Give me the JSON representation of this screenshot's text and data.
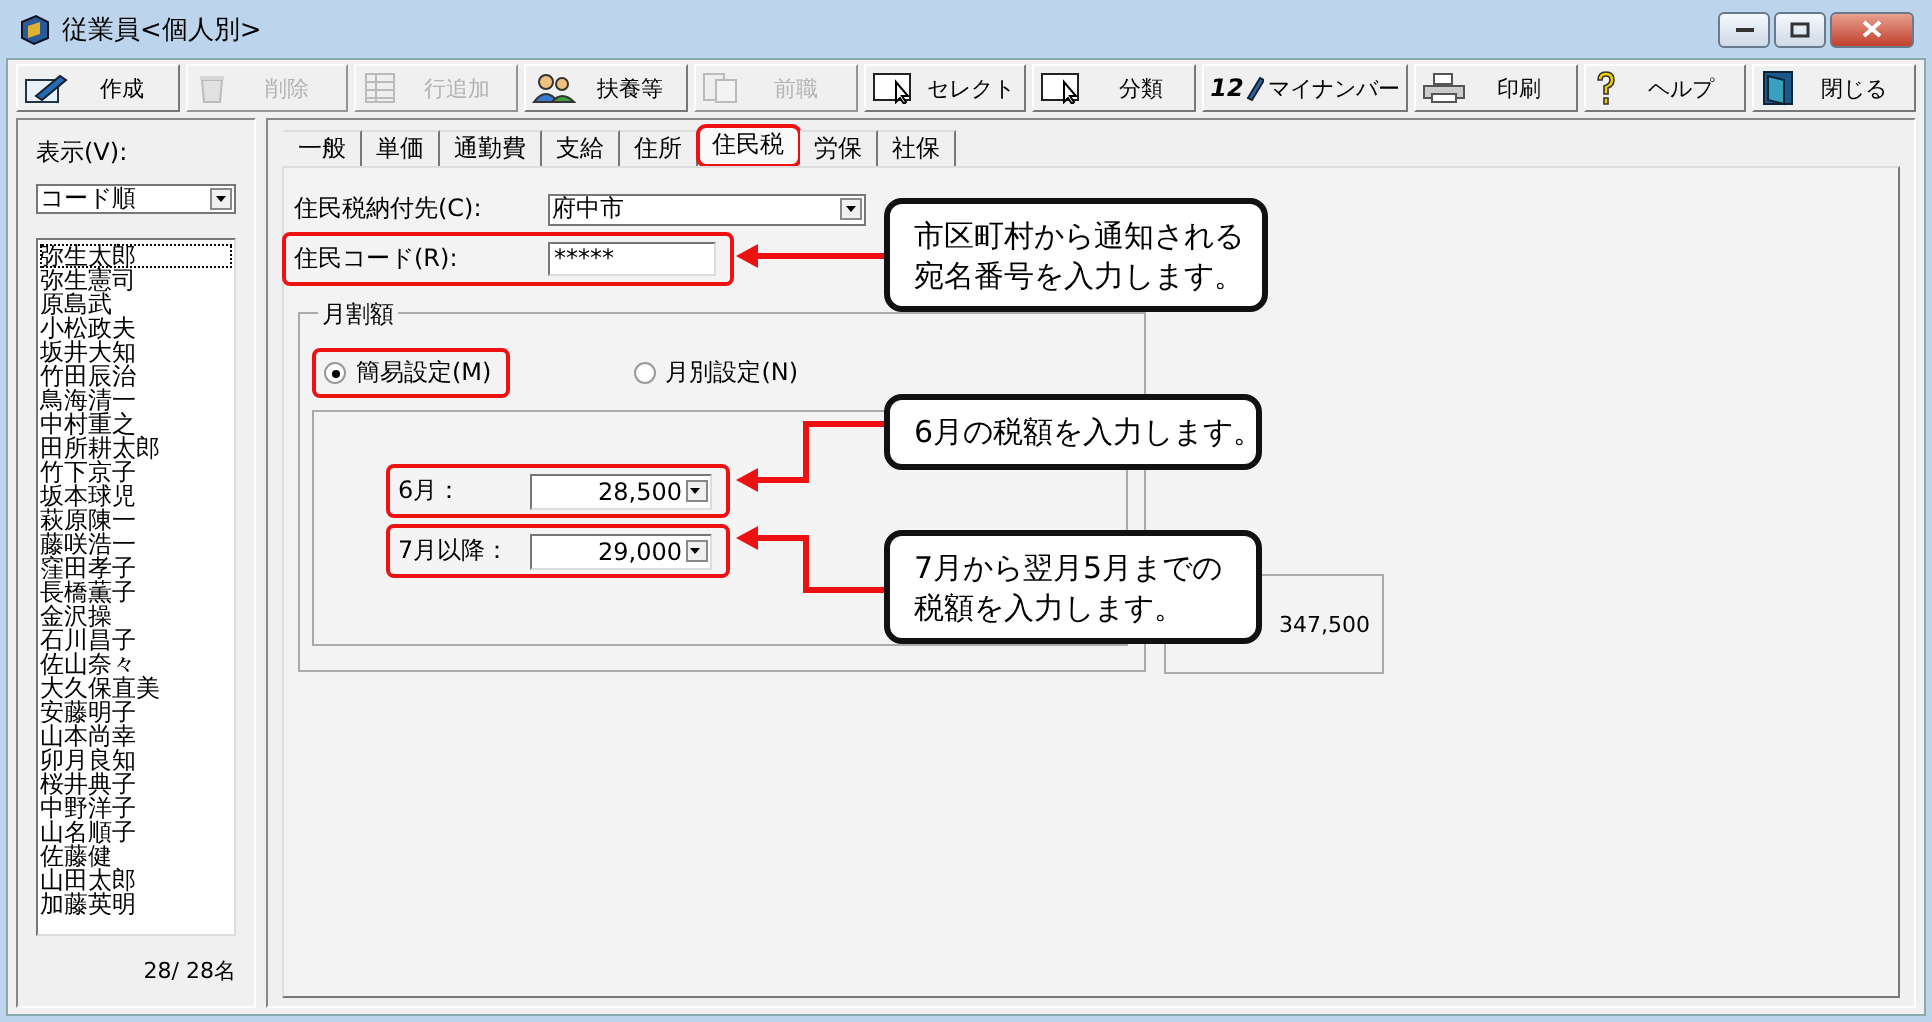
{
  "window": {
    "title": "従業員<個人別>"
  },
  "toolbar": [
    {
      "label": "作成",
      "kind": "edit",
      "disabled": false
    },
    {
      "label": "削除",
      "kind": "trash",
      "disabled": true
    },
    {
      "label": "行追加",
      "kind": "grid",
      "disabled": true
    },
    {
      "label": "扶養等",
      "kind": "people",
      "disabled": false
    },
    {
      "label": "前職",
      "kind": "docs",
      "disabled": true
    },
    {
      "label": "セレクト",
      "kind": "pointer",
      "disabled": false
    },
    {
      "label": "分類",
      "kind": "pointer",
      "disabled": false
    },
    {
      "label": "マイナンバー",
      "kind": "number",
      "badge": "12",
      "disabled": false
    },
    {
      "label": "印刷",
      "kind": "printer",
      "disabled": false
    },
    {
      "label": "ヘルプ",
      "kind": "help",
      "disabled": false
    },
    {
      "label": "閉じる",
      "kind": "exit",
      "disabled": false
    }
  ],
  "sidebar": {
    "view_label": "表示(V):",
    "sort": "コード順",
    "employees": [
      {
        "name": "弥生太郎",
        "selected": true
      },
      {
        "name": "弥生憲司",
        "selected": false
      },
      {
        "name": "原島武",
        "selected": false
      },
      {
        "name": "小松政夫",
        "selected": false
      },
      {
        "name": "坂井大知",
        "selected": false
      },
      {
        "name": "竹田辰治",
        "selected": false
      },
      {
        "name": "鳥海清一",
        "selected": false
      },
      {
        "name": "中村重之",
        "selected": false
      },
      {
        "name": "田所耕太郎",
        "selected": false
      },
      {
        "name": "竹下京子",
        "selected": false
      },
      {
        "name": "坂本球児",
        "selected": false
      },
      {
        "name": "萩原陳一",
        "selected": false
      },
      {
        "name": "藤咲浩一",
        "selected": false
      },
      {
        "name": "窪田孝子",
        "selected": false
      },
      {
        "name": "長橋薫子",
        "selected": false
      },
      {
        "name": "金沢操",
        "selected": false
      },
      {
        "name": "石川昌子",
        "selected": false
      },
      {
        "name": "佐山奈々",
        "selected": false
      },
      {
        "name": "大久保直美",
        "selected": false
      },
      {
        "name": "安藤明子",
        "selected": false
      },
      {
        "name": "山本尚幸",
        "selected": false
      },
      {
        "name": "卯月良知",
        "selected": false
      },
      {
        "name": "桜井典子",
        "selected": false
      },
      {
        "name": "中野洋子",
        "selected": false
      },
      {
        "name": "山名順子",
        "selected": false
      },
      {
        "name": "佐藤健",
        "selected": false
      },
      {
        "name": "山田太郎",
        "selected": false
      },
      {
        "name": "加藤英明",
        "selected": false
      }
    ],
    "count": "28/  28名"
  },
  "tabs": [
    {
      "label": "一般",
      "selected": false,
      "highlighted": false
    },
    {
      "label": "単価",
      "selected": false,
      "highlighted": false
    },
    {
      "label": "通勤費",
      "selected": false,
      "highlighted": false
    },
    {
      "label": "支給",
      "selected": false,
      "highlighted": false
    },
    {
      "label": "住所",
      "selected": false,
      "highlighted": false
    },
    {
      "label": "住民税",
      "selected": true,
      "highlighted": true
    },
    {
      "label": "労保",
      "selected": false,
      "highlighted": false
    },
    {
      "label": "社保",
      "selected": false,
      "highlighted": false
    }
  ],
  "form": {
    "payee": {
      "label": "住民税納付先(C):",
      "value": "府中市"
    },
    "resident_code": {
      "label": "住民コード(R):",
      "value": "*****",
      "highlighted": true
    },
    "monthly": {
      "title": "月割額",
      "modes": [
        {
          "label": "簡易設定(M)",
          "selected": true,
          "highlighted": true
        },
        {
          "label": "月別設定(N)",
          "selected": false,
          "highlighted": false
        }
      ],
      "amounts": [
        {
          "label": "6月：",
          "value": "28,500",
          "highlighted": true
        },
        {
          "label": "7月以降：",
          "value": "29,000",
          "highlighted": true
        }
      ]
    },
    "total": "347,500"
  },
  "callouts": [
    {
      "lines": [
        "市区町村から通知される",
        "宛名番号を入力します。"
      ]
    },
    {
      "lines": [
        "6月の税額を入力します。"
      ]
    },
    {
      "lines": [
        "7月から翌月5月までの",
        "税額を入力します。"
      ]
    }
  ]
}
